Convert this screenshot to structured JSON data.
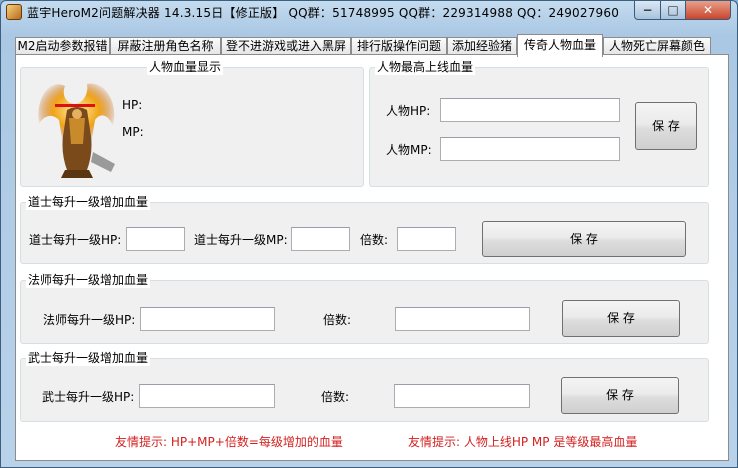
{
  "window": {
    "title": "蓝宇HeroM2问题解决器 14.3.15日【修正版】 QQ群：51748995 QQ群：229314988 QQ：249027960",
    "minimize_glyph": "−",
    "maximize_glyph": "□",
    "close_glyph": "✕"
  },
  "tabs": [
    {
      "label": "M2启动参数报错"
    },
    {
      "label": "屏蔽注册角色名称"
    },
    {
      "label": "登不进游戏或进入黑屏"
    },
    {
      "label": "排行版操作问题"
    },
    {
      "label": "添加经验猪"
    },
    {
      "label": "传奇人物血量"
    },
    {
      "label": "人物死亡屏幕颜色"
    }
  ],
  "active_tab": "传奇人物血量",
  "display_group": {
    "title": "人物血量显示",
    "hp_label": "HP:",
    "mp_label": "MP:"
  },
  "max_group": {
    "title": "人物最高上线血量",
    "hp_label": "人物HP:",
    "mp_label": "人物MP:",
    "hp_value": "",
    "mp_value": "",
    "save_label": "保 存"
  },
  "taoist_group": {
    "title": "道士每升一级增加血量",
    "hp_label": "道士每升一级HP:",
    "mp_label": "道士每升一级MP:",
    "multiplier_label": "倍数:",
    "hp_value": "",
    "mp_value": "",
    "multiplier_value": "",
    "save_label": "保 存"
  },
  "mage_group": {
    "title": "法师每升一级增加血量",
    "hp_label": "法师每升一级HP:",
    "multiplier_label": "倍数:",
    "hp_value": "",
    "multiplier_value": "",
    "save_label": "保 存"
  },
  "warrior_group": {
    "title": "武士每升一级增加血量",
    "hp_label": "武士每升一级HP:",
    "multiplier_label": "倍数:",
    "hp_value": "",
    "multiplier_value": "",
    "save_label": "保 存"
  },
  "hints": {
    "left": "友情提示: HP+MP+倍数=每级增加的血量",
    "right": "友情提示: 人物上线HP MP 是等级最高血量"
  },
  "colors": {
    "hint_red": "#d42020",
    "title_bar": "#b4cfe8",
    "close_button": "#c9462c"
  }
}
